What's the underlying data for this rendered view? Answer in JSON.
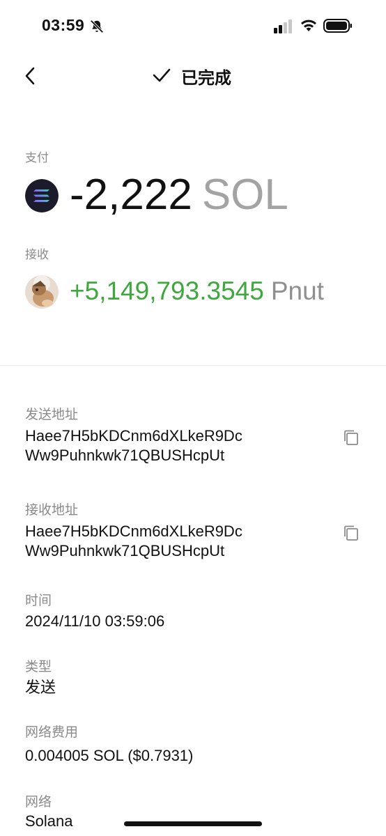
{
  "status_bar": {
    "time": "03:59"
  },
  "header": {
    "title": "已完成"
  },
  "payment": {
    "label": "支付",
    "amount": "-2,222",
    "unit": "SOL"
  },
  "receive": {
    "label": "接收",
    "amount": "+5,149,793.3545",
    "unit": "Pnut"
  },
  "details": {
    "send_address": {
      "label": "发送地址",
      "line1": "Haee7H5bKDCnm6dXLkeR9Dc",
      "line2": "Ww9Puhnkwk71QBUSHcpUt"
    },
    "receive_address": {
      "label": "接收地址",
      "line1": "Haee7H5bKDCnm6dXLkeR9Dc",
      "line2": "Ww9Puhnkwk71QBUSHcpUt"
    },
    "time": {
      "label": "时间",
      "value": "2024/11/10 03:59:06"
    },
    "type": {
      "label": "类型",
      "value": "发送"
    },
    "fee": {
      "label": "网络费用",
      "value": "0.004005 SOL ($0.7931)"
    },
    "network": {
      "label": "网络",
      "value": "Solana"
    }
  },
  "colors": {
    "positive": "#3ea83e",
    "muted": "#8a8a8a",
    "text": "#111111"
  },
  "icons": [
    "bell-slash-icon",
    "signal-icon",
    "wifi-icon",
    "battery-icon",
    "back-chevron-icon",
    "check-icon",
    "solana-logo",
    "pnut-avatar",
    "copy-icon"
  ]
}
